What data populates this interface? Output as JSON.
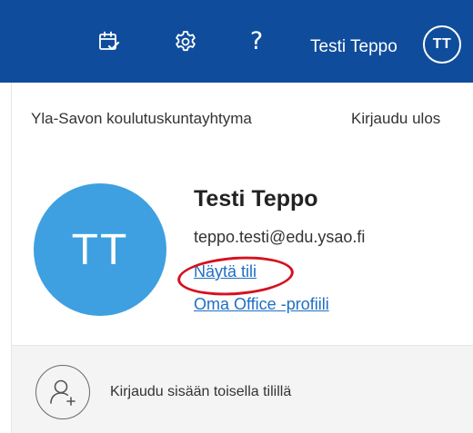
{
  "header": {
    "user_name": "Testi Teppo",
    "user_initials": "TT",
    "help_glyph": "?",
    "icons": [
      "calendar-check-icon",
      "gear-icon",
      "help-icon"
    ],
    "background_color": "#0f4d9c"
  },
  "account_panel": {
    "organization": "Yla-Savon koulutuskuntayhtyma",
    "sign_out_label": "Kirjaudu ulos",
    "profile": {
      "initials": "TT",
      "name": "Testi Teppo",
      "email": "teppo.testi@edu.ysao.fi",
      "view_account_link": "Näytä tili",
      "office_profile_link": "Oma Office -profiili",
      "avatar_color": "#3ea0e0"
    },
    "other_account": {
      "label": "Kirjaudu sisään toisella tilillä",
      "icon": "add-user-icon"
    }
  },
  "annotation": {
    "highlight_color": "#d4121f"
  }
}
